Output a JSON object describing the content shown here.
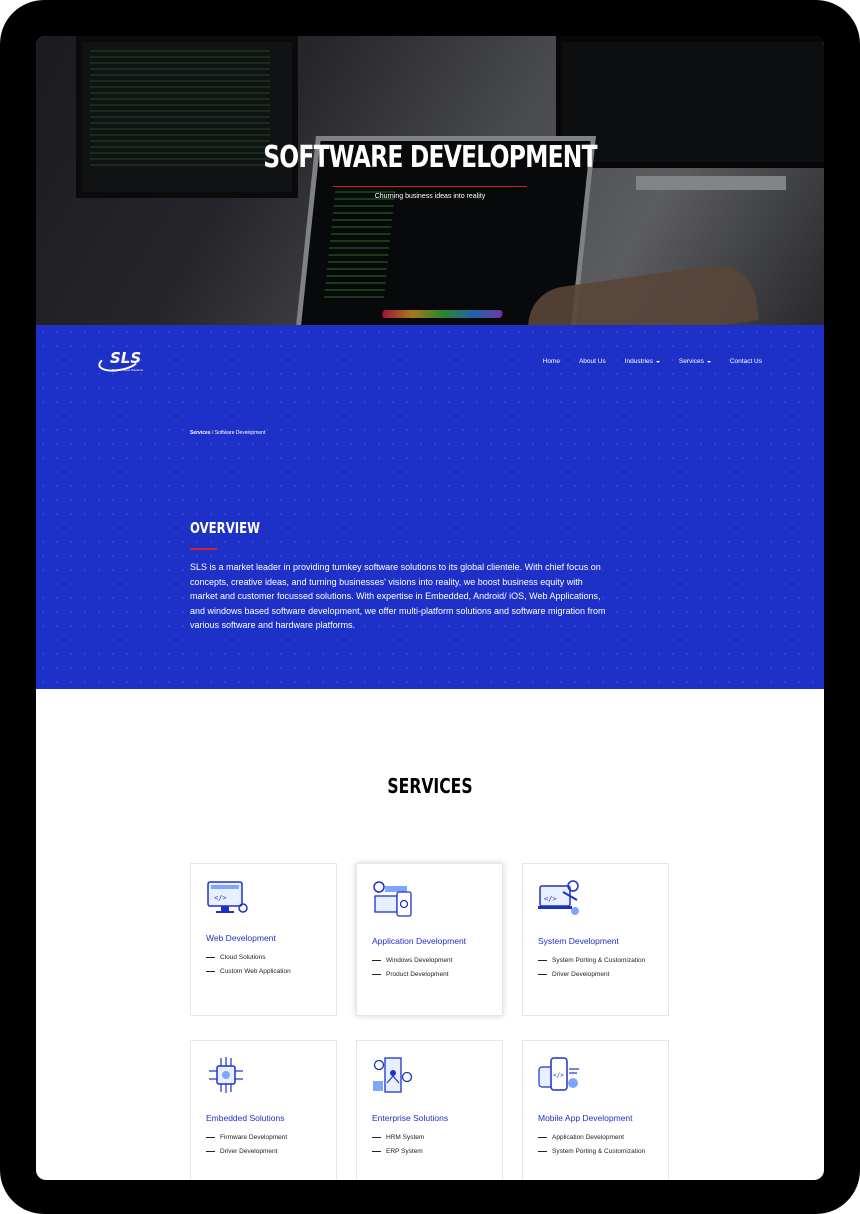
{
  "hero": {
    "title": "SOFTWARE DEVELOPMENT",
    "subtitle": "Churning business ideas into reality"
  },
  "brand": {
    "logo_text": "SLS",
    "logo_tagline": "System Level Solutions",
    "accent_color": "#d31f2b",
    "band_color": "#1d31c9"
  },
  "nav": {
    "items": [
      {
        "label": "Home",
        "dropdown": false
      },
      {
        "label": "About Us",
        "dropdown": false
      },
      {
        "label": "Industries",
        "dropdown": true
      },
      {
        "label": "Services",
        "dropdown": true
      },
      {
        "label": "Contact Us",
        "dropdown": false
      }
    ]
  },
  "breadcrumb": {
    "parent": "Services",
    "separator": " / ",
    "current": "Software Development"
  },
  "overview": {
    "heading": "OVERVIEW",
    "body": "SLS is a market leader in providing turnkey software solutions to its global clientele. With chief focus on concepts, creative ideas, and turning businesses' visions into reality, we boost business equity with market and customer focussed solutions. With expertise in Embedded, Android/ iOS, Web Applications, and windows based software development, we offer multi-platform solutions and software migration from various software and hardware platforms."
  },
  "services": {
    "heading": "SERVICES",
    "cards": [
      {
        "title": "Web Development",
        "icon": "web-monitor-icon",
        "items": [
          "Cloud Solutions",
          "Custom Web Application"
        ]
      },
      {
        "title": "Application Development",
        "icon": "app-gears-icon",
        "items": [
          "Windows Development",
          "Product Development"
        ]
      },
      {
        "title": "System Development",
        "icon": "system-tools-icon",
        "items": [
          "System Porting & Customization",
          "Driver Development"
        ]
      },
      {
        "title": "Embedded Solutions",
        "icon": "chip-icon",
        "items": [
          "Firmware Development",
          "Driver Development"
        ]
      },
      {
        "title": "Enterprise Solutions",
        "icon": "enterprise-building-icon",
        "items": [
          "HRM System",
          "ERP System"
        ]
      },
      {
        "title": "Mobile App Development",
        "icon": "mobile-app-icon",
        "items": [
          "Application Development",
          "System Porting & Customization"
        ]
      }
    ]
  }
}
